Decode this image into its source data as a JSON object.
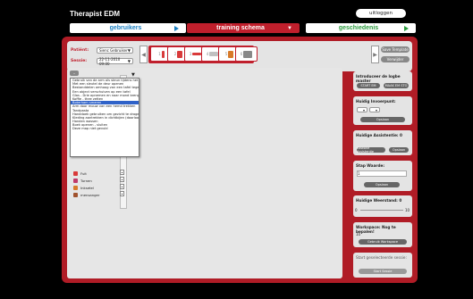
{
  "app": {
    "title": "Therapist EDM",
    "logout_label": "uitloggen"
  },
  "nav": {
    "users": "gebruikers",
    "training": "training schema",
    "history": "geschiedenis"
  },
  "toolbar": {
    "patient_label": "Patiënt:",
    "patient_value": "Sienc Gebruiker",
    "session_label": "Sessie:",
    "session_value": "22-11-2010 09:00",
    "slots": [
      "1",
      "2",
      "3",
      "4",
      "5",
      "6"
    ],
    "save_label": "Save Template",
    "delete_label": "Verwijder"
  },
  "dropdown": {
    "options": [
      "Gebruik van de arm als steun tijdens het uitvoeren van handelin",
      "Met een sleutel de deur openen",
      "Bestanddelen omhoog van een tafel tegen de zijkant tillen",
      "Een object verschuiven op een tafel",
      "Glas - Drie opnemen en naar mond brengen en terug brengen",
      "Koffie - thee zetten",
      "Boterham smeren",
      "Arm door mouw van een hemd trekken",
      "Tandpasta",
      "Handdoek gebruiken om gezicht te drogen",
      "Kleding aantrekken in dichtbijen (doorloopt kleding)",
      "Handen wassen",
      "Boek openen - sluiten",
      "Deze map niet gevuld"
    ],
    "selected_index": 6
  },
  "exercises": [
    {
      "name": "Fuit",
      "color": "#d93a3a"
    },
    {
      "name": "Turnen",
      "color": "#c03a6a"
    },
    {
      "name": "Inksetel",
      "color": "#d87a2a"
    },
    {
      "name": "mensanger",
      "color": "#a0522d"
    }
  ],
  "side": {
    "intro_title": "Introduceer de logbe master",
    "intro_start": "START EM",
    "intro_stop": "MAAK EM STO",
    "current_title": "Huidig Invoerpunt:",
    "current_opt_a": "",
    "current_opt_b": "",
    "current_btn": "Opslaan",
    "amount_title": "Huidige Assistentie:",
    "amount_value": "0",
    "amount_btn_a": "Gewone Assistentie",
    "amount_btn_b": "Opslaan",
    "duration_title": "Stap Waarde:",
    "duration_value": "1",
    "duration_btn": "Opslaan",
    "resistance_title": "Huidige Weerstand:",
    "resistance_value": "0",
    "resistance_min": "0",
    "resistance_max": "10",
    "workspace_title": "Workspace:",
    "workspace_note": "Nog te bepalen!",
    "workspace_value": "10",
    "workspace_btn": "Gebruik Workspace",
    "start_title": "Start geselecteerde sessie:",
    "start_btn": "Start Sessie"
  },
  "colors": {
    "accent_red": "#c01f2c",
    "blue": "#1a7fc1",
    "green": "#2a9a3c"
  }
}
